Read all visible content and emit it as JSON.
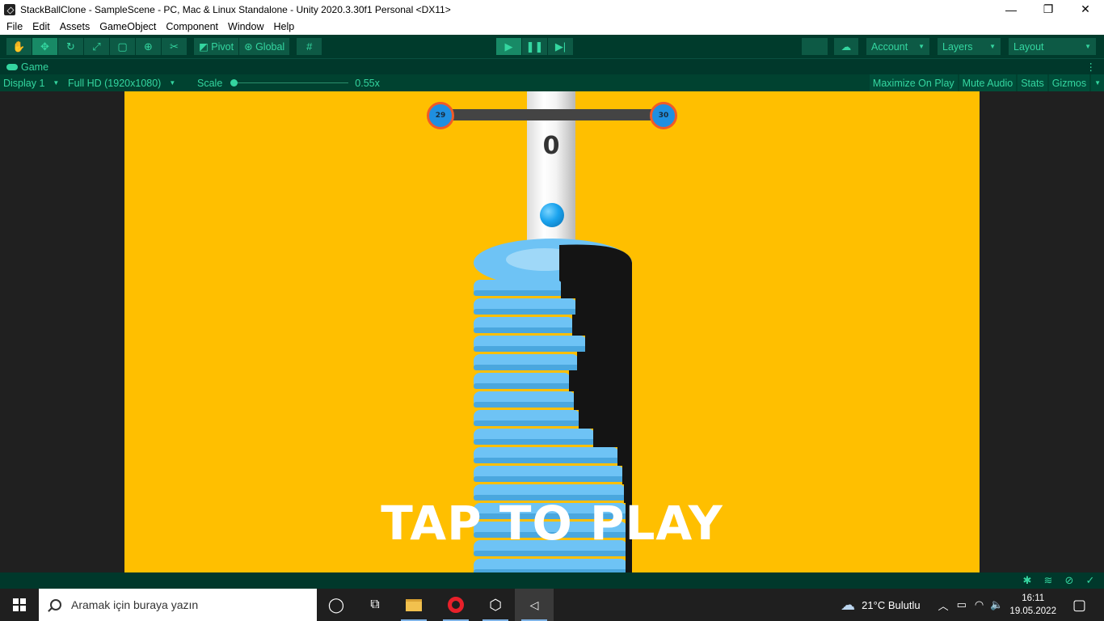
{
  "window": {
    "title": "StackBallClone - SampleScene - PC, Mac & Linux Standalone - Unity 2020.3.30f1 Personal <DX11>",
    "minimize": "—",
    "maximize": "❐",
    "close": "✕"
  },
  "menu": [
    "File",
    "Edit",
    "Assets",
    "GameObject",
    "Component",
    "Window",
    "Help"
  ],
  "toolbar": {
    "pivot": "Pivot",
    "global": "Global",
    "account": "Account",
    "layers": "Layers",
    "layout": "Layout"
  },
  "tab": {
    "label": "Game"
  },
  "gamebar": {
    "display": "Display 1",
    "resolution": "Full HD (1920x1080)",
    "scale_label": "Scale",
    "scale_value": "0.55x",
    "maximize": "Maximize On Play",
    "mute": "Mute Audio",
    "stats": "Stats",
    "gizmos": "Gizmos"
  },
  "game": {
    "level_current": "29",
    "level_next": "30",
    "level_progress": 0,
    "score": "0",
    "prompt": "TAP TO PLAY",
    "colors": {
      "background": "#ffbf00",
      "ring": "#6ec3f5",
      "ring_dark": "#141414",
      "ball": "#1aa3ee"
    }
  },
  "taskbar": {
    "search_placeholder": "Aramak için buraya yazın",
    "weather": "21°C  Bulutlu",
    "time": "16:11",
    "date": "19.05.2022"
  }
}
